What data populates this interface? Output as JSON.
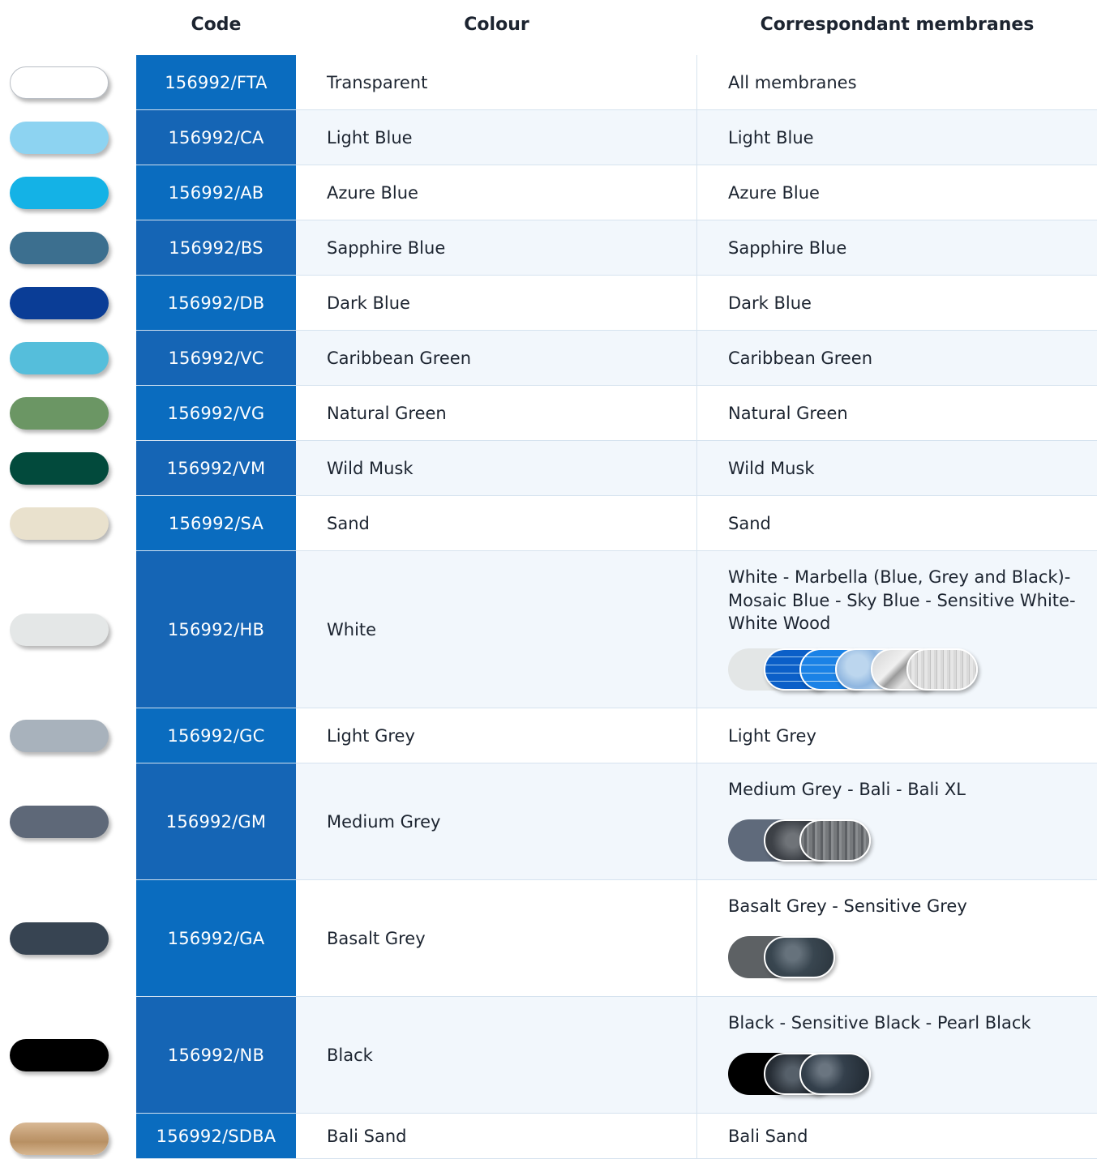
{
  "headers": {
    "code": "Code",
    "colour": "Colour",
    "membranes": "Correspondant membranes"
  },
  "rows": [
    {
      "code": "156992/FTA",
      "colour": "Transparent",
      "membranes": "All membranes",
      "swatch": "#ffffff",
      "code_bg": "#0a6cbf",
      "row_bg": "#ffffff"
    },
    {
      "code": "156992/CA",
      "colour": "Light Blue",
      "membranes": "Light Blue",
      "swatch": "#8dd3f1",
      "code_bg": "#1565b5",
      "row_bg": "#f2f7fc"
    },
    {
      "code": "156992/AB",
      "colour": "Azure Blue",
      "membranes": "Azure Blue",
      "swatch": "#14b2e6",
      "code_bg": "#0a6cbf",
      "row_bg": "#ffffff"
    },
    {
      "code": "156992/BS",
      "colour": "Sapphire Blue",
      "membranes": "Sapphire Blue",
      "swatch": "#3c6f8f",
      "code_bg": "#1565b5",
      "row_bg": "#f2f7fc"
    },
    {
      "code": "156992/DB",
      "colour": "Dark Blue",
      "membranes": "Dark Blue",
      "swatch": "#0a3d96",
      "code_bg": "#0a6cbf",
      "row_bg": "#ffffff"
    },
    {
      "code": "156992/VC",
      "colour": "Caribbean Green",
      "membranes": "Caribbean Green",
      "swatch": "#55bedb",
      "code_bg": "#1565b5",
      "row_bg": "#f2f7fc"
    },
    {
      "code": "156992/VG",
      "colour": "Natural Green",
      "membranes": "Natural Green",
      "swatch": "#6b9664",
      "code_bg": "#0a6cbf",
      "row_bg": "#ffffff"
    },
    {
      "code": "156992/VM",
      "colour": "Wild Musk",
      "membranes": "Wild Musk",
      "swatch": "#024a3c",
      "code_bg": "#1565b5",
      "row_bg": "#f2f7fc"
    },
    {
      "code": "156992/SA",
      "colour": "Sand",
      "membranes": "Sand",
      "swatch": "#e9e1cd",
      "code_bg": "#0a6cbf",
      "row_bg": "#ffffff"
    },
    {
      "code": "156992/HB",
      "colour": "White",
      "membranes": "White - Marbella (Blue, Grey and Black)- Mosaic Blue - Sky Blue - Sensitive White- White Wood",
      "swatch": "#e4e7e7",
      "code_bg": "#1565b5",
      "row_bg": "#f2f7fc",
      "samples": [
        "white",
        "mosaic-blue",
        "mosaic-blue-light",
        "sky-blue",
        "marble-grey",
        "white-wood"
      ]
    },
    {
      "code": "156992/GC",
      "colour": "Light Grey",
      "membranes": "Light Grey",
      "swatch": "#a8b2bc",
      "code_bg": "#0a6cbf",
      "row_bg": "#ffffff"
    },
    {
      "code": "156992/GM",
      "colour": "Medium Grey",
      "membranes": "Medium Grey - Bali - Bali XL",
      "swatch": "#5e6878",
      "code_bg": "#1565b5",
      "row_bg": "#f2f7fc",
      "samples": [
        "medium-grey",
        "bali",
        "bali-xl"
      ]
    },
    {
      "code": "156992/GA",
      "colour": "Basalt Grey",
      "membranes": "Basalt Grey - Sensitive Grey",
      "swatch": "#374452",
      "code_bg": "#0a6cbf",
      "row_bg": "#ffffff",
      "samples": [
        "basalt-grey",
        "sensitive-grey"
      ]
    },
    {
      "code": "156992/NB",
      "colour": "Black",
      "membranes": "Black - Sensitive Black - Pearl Black",
      "swatch": "#000000",
      "code_bg": "#1565b5",
      "row_bg": "#f2f7fc",
      "samples": [
        "black",
        "sensitive-black",
        "pearl-black"
      ]
    },
    {
      "code": "156992/SDBA",
      "colour": "Bali Sand",
      "membranes": "Bali Sand",
      "swatch": "#c9a57f",
      "code_bg": "#0a6cbf",
      "row_bg": "#ffffff"
    }
  ]
}
